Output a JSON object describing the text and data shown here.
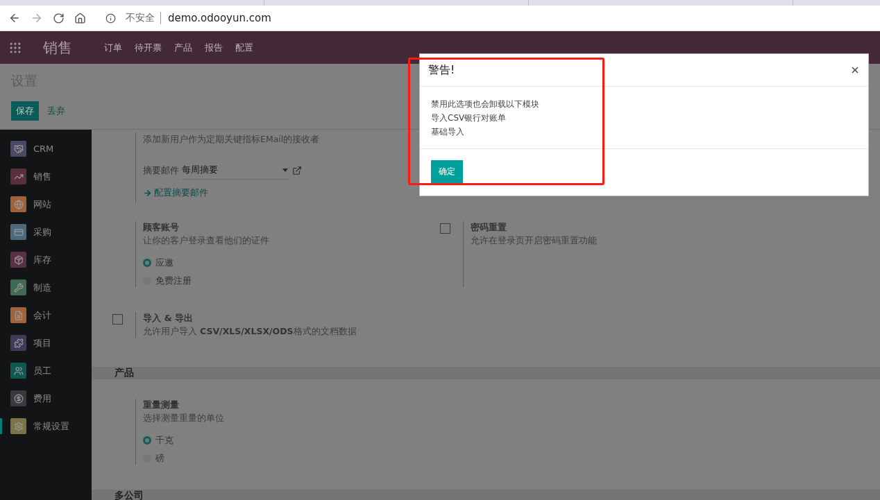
{
  "browser": {
    "security": "不安全",
    "url": "demo.odooyun.com"
  },
  "navbar": {
    "app_name": "销售",
    "menu": [
      "订单",
      "待开票",
      "产品",
      "报告",
      "配置"
    ]
  },
  "control_panel": {
    "breadcrumb": "设置",
    "buttons": [
      {
        "label": "保存",
        "kind": "primary"
      },
      {
        "label": "丢弃",
        "kind": "link"
      }
    ]
  },
  "sidebar": {
    "items": [
      {
        "label": "CRM",
        "selected": false
      },
      {
        "label": "销售",
        "selected": false
      },
      {
        "label": "网站",
        "selected": false
      },
      {
        "label": "采购",
        "selected": false
      },
      {
        "label": "库存",
        "selected": false
      },
      {
        "label": "制造",
        "selected": false
      },
      {
        "label": "会计",
        "selected": false
      },
      {
        "label": "项目",
        "selected": false
      },
      {
        "label": "员工",
        "selected": false
      },
      {
        "label": "费用",
        "selected": false
      },
      {
        "label": "常规设置",
        "selected": true
      }
    ]
  },
  "settings": [
    {
      "kind": "digest",
      "description": "添加新用户作为定期关键指标EMail的接收者",
      "field_label": "摘要邮件",
      "field_value": "每周摘要",
      "link": "配置摘要邮件"
    },
    {
      "kind": "pair",
      "items": [
        {
          "title": "顾客账号",
          "description": "让你的客户登录查看他们的证件",
          "options": [
            {
              "label": "应邀",
              "selected": true
            },
            {
              "label": "免费注册",
              "selected": false
            }
          ]
        },
        {
          "title": "密码重置",
          "description": "允许在登录页开启密码重置功能",
          "checked": false
        }
      ]
    },
    {
      "kind": "pair",
      "items": [
        {
          "title": "导入 & 导出",
          "description": "允许用户导入 **CSV/XLS/XLSX/ODS**格式的文档数据",
          "checked": false
        }
      ]
    },
    {
      "kind": "header",
      "title": "产品"
    },
    {
      "kind": "pair",
      "items": [
        {
          "title": "重量测量",
          "description": "选择测量重量的单位",
          "options": [
            {
              "label": "千克",
              "selected": true
            },
            {
              "label": "磅",
              "selected": false
            }
          ]
        }
      ]
    },
    {
      "kind": "header",
      "title": "多公司"
    }
  ],
  "dialog": {
    "title": "警告!",
    "lines": [
      "禁用此选项也会卸载以下模块",
      "导入CSV银行对账单",
      "基础导入"
    ],
    "button": "确定"
  }
}
